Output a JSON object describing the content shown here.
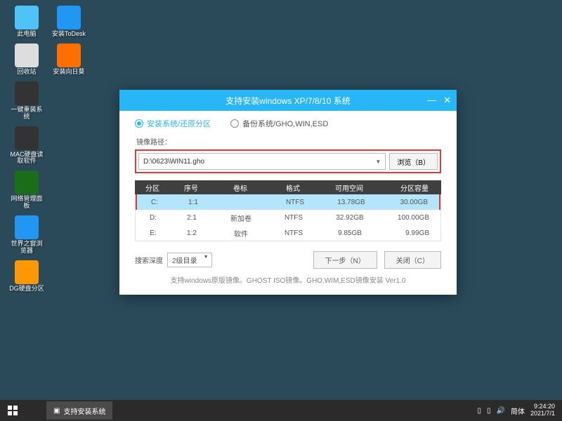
{
  "desktop": {
    "col1": [
      {
        "label": "此电脑",
        "color": "#4fc3f7"
      },
      {
        "label": "回收站",
        "color": "#ddd"
      },
      {
        "label": "一键重装系统",
        "color": "#333"
      },
      {
        "label": "MAC硬盘读取软件",
        "color": "#333"
      },
      {
        "label": "网络管理面板",
        "color": "#1a6e1a"
      },
      {
        "label": "世界之窗浏览器",
        "color": "#2196f3"
      },
      {
        "label": "DG硬盘分区",
        "color": "#ff9800"
      }
    ],
    "col2": [
      {
        "label": "安装ToDesk",
        "color": "#2196f3"
      },
      {
        "label": "安装向日葵",
        "color": "#ff6f00"
      }
    ]
  },
  "window": {
    "title": "支持安装windows XP/7/8/10 系统",
    "radio1": "安装系统/还原分区",
    "radio2": "备份系统/GHO,WIN,ESD",
    "pathLabel": "镜像路径：",
    "path": "D:\\0623\\WIN11.gho",
    "browse": "浏览（B）",
    "headers": {
      "c1": "分区",
      "c2": "序号",
      "c3": "卷标",
      "c4": "格式",
      "c5": "可用空间",
      "c6": "分区容量"
    },
    "rows": [
      {
        "drive": "C:",
        "idx": "1:1",
        "label": "",
        "fmt": "NTFS",
        "free": "13.78GB",
        "total": "30.00GB",
        "selected": true
      },
      {
        "drive": "D:",
        "idx": "2:1",
        "label": "新加卷",
        "fmt": "NTFS",
        "free": "32.92GB",
        "total": "100.00GB"
      },
      {
        "drive": "E:",
        "idx": "1:2",
        "label": "软件",
        "fmt": "NTFS",
        "free": "9.85GB",
        "total": "9.99GB"
      }
    ],
    "searchLabel": "搜索深度",
    "searchValue": "2级目录",
    "next": "下一步（N）",
    "close": "关闭（C）",
    "footer": "支持windows原版镜像。GHOST ISO镜像。GHO,WIM,ESD镜像安装 Ver1.0"
  },
  "taskbar": {
    "app": "支持安装系统",
    "lang": "简体",
    "time": "9:24:20",
    "date": "2021/7/1"
  }
}
